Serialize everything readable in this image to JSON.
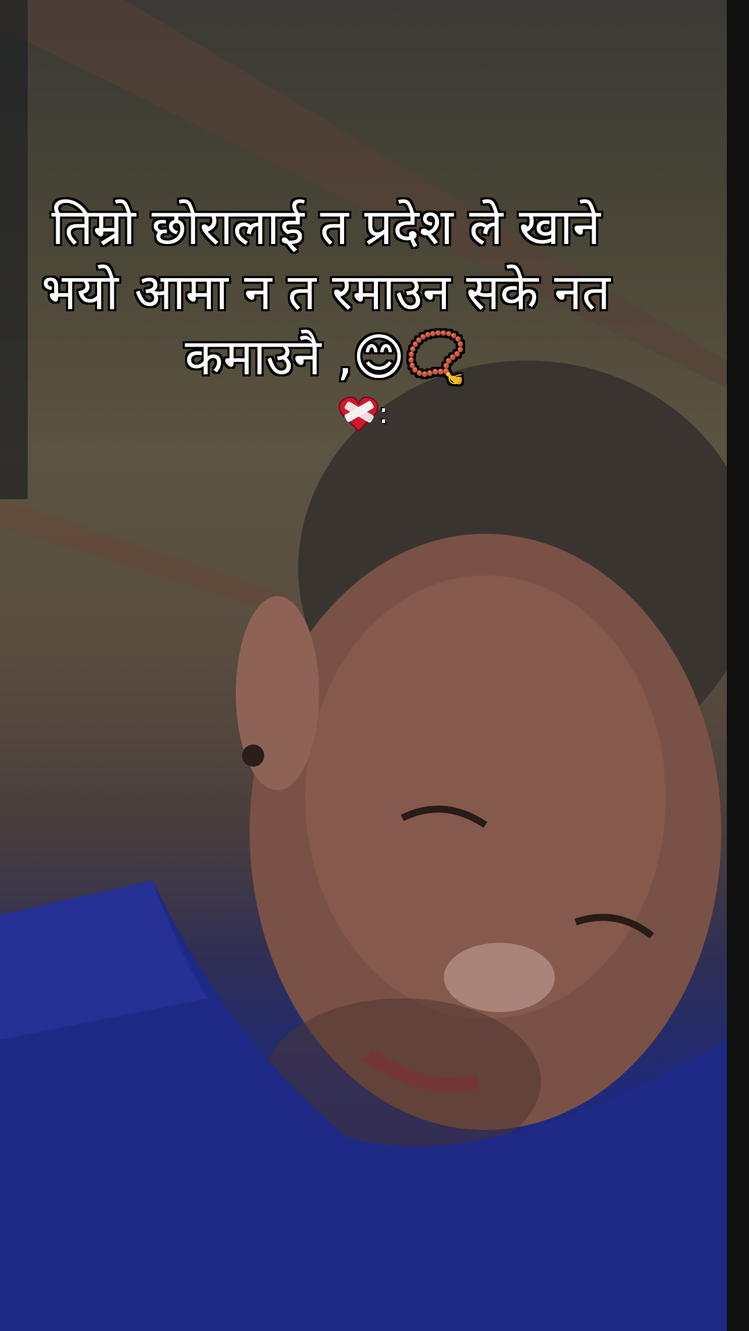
{
  "caption": {
    "line1": "तिम्रो छोरालाई त प्रदेश ले खाने",
    "line2": "भयो आमा न त रमाउन सके नत",
    "line3": "कमाउनै ,😊📿",
    "line4_suffix": ":"
  },
  "icons": {
    "smile": "smiling-face-icon",
    "beads": "prayer-beads-icon",
    "heart": "mending-heart-icon"
  },
  "colors": {
    "caption_text": "#ffffff",
    "caption_outline": "#000000",
    "shirt": "#1e2a86"
  }
}
